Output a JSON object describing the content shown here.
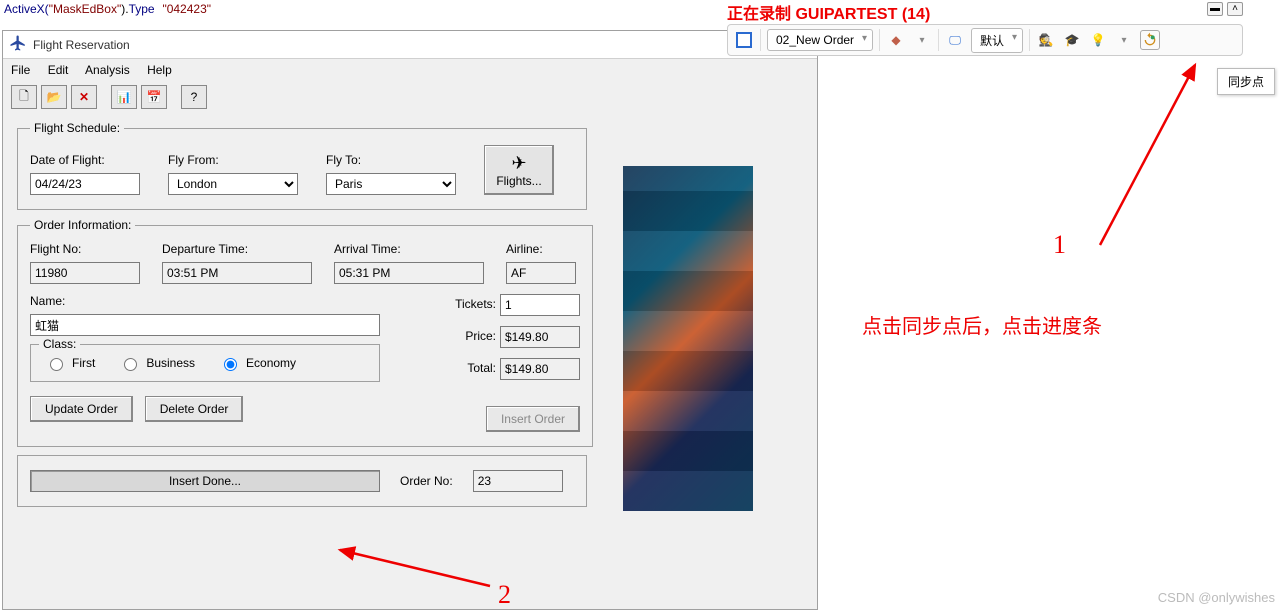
{
  "code": {
    "object": "MaskEdBox",
    "method": "Type",
    "value": "042423",
    "prefix": "ActiveX("
  },
  "window": {
    "title": "Flight Reservation",
    "minimize": "—",
    "menu": {
      "file": "File",
      "edit": "Edit",
      "analysis": "Analysis",
      "help": "Help"
    }
  },
  "toolbar": {
    "new": "🗋",
    "open": "📂",
    "delete": "✕",
    "chart": "📊",
    "calendar": "📅",
    "help": "?"
  },
  "schedule": {
    "legend": "Flight Schedule:",
    "date_label": "Date of Flight:",
    "date_value": "04/24/23",
    "from_label": "Fly From:",
    "from_value": "London",
    "to_label": "Fly To:",
    "to_value": "Paris",
    "flights_btn": "Flights..."
  },
  "order": {
    "legend": "Order Information:",
    "flightno_label": "Flight No:",
    "flightno": "11980",
    "dep_label": "Departure Time:",
    "dep": "03:51 PM",
    "arr_label": "Arrival Time:",
    "arr": "05:31 PM",
    "airline_label": "Airline:",
    "airline": "AF",
    "name_label": "Name:",
    "name": "虹猫",
    "tickets_label": "Tickets:",
    "tickets": "1",
    "price_label": "Price:",
    "price": "$149.80",
    "total_label": "Total:",
    "total": "$149.80",
    "class_legend": "Class:",
    "class_first": "First",
    "class_business": "Business",
    "class_economy": "Economy",
    "update_btn": "Update Order",
    "delete_btn": "Delete Order",
    "insert_btn": "Insert Order"
  },
  "bottom": {
    "progress_text": "Insert Done...",
    "orderno_label": "Order No:",
    "orderno": "23"
  },
  "recording": {
    "header": "正在录制 GUIPARTEST (14)",
    "action": "02_New Order",
    "combo2": "默认",
    "tooltip": "同步点"
  },
  "annotations": {
    "num1": "1",
    "num2": "2",
    "text1": "点击同步点后，点击进度条"
  },
  "watermark": "CSDN @onlywishes"
}
